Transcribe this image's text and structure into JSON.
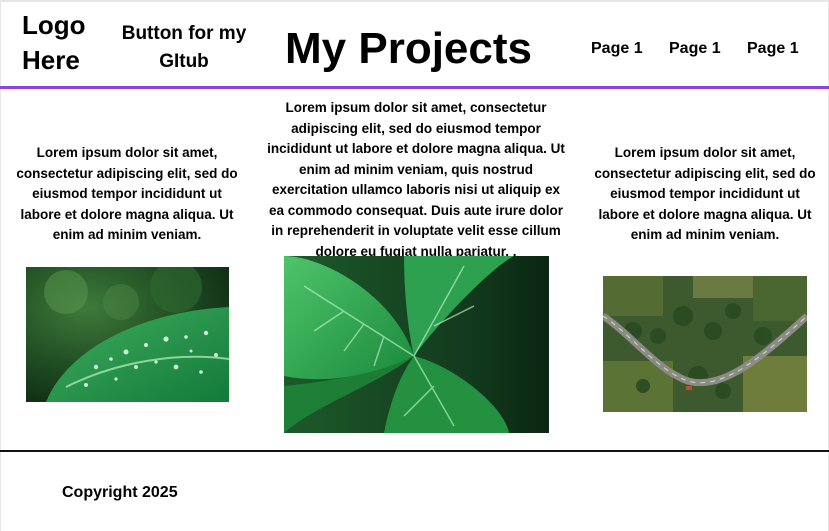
{
  "header": {
    "logo_line1": "Logo",
    "logo_line2": "Here",
    "github_button_line1": "Button for my",
    "github_button_line2": "GItub",
    "title": "My Projects",
    "nav": [
      "Page 1",
      "Page 1",
      "Page 1"
    ],
    "accent_color": "#8b43e0"
  },
  "columns": [
    {
      "text": "Lorem ipsum dolor sit amet, consectetur adipiscing elit, sed do eiusmod tempor incididunt ut labore et dolore magna aliqua. Ut enim ad minim veniam.",
      "image": "leaf-with-water-droplets"
    },
    {
      "text": "Lorem ipsum dolor sit amet, consectetur adipiscing elit, sed do eiusmod tempor incididunt ut labore et dolore magna aliqua. Ut enim ad minim veniam, quis nostrud exercitation ullamco laboris nisi ut aliquip ex ea commodo consequat. Duis aute irure dolor in reprehenderit in voluptate velit esse cillum dolore eu fugiat nulla pariatur. .",
      "image": "green-leaves-closeup"
    },
    {
      "text": "Lorem ipsum dolor sit amet, consectetur adipiscing elit, sed do eiusmod tempor incididunt ut labore et dolore magna aliqua. Ut enim ad minim veniam.",
      "image": "aerial-road-through-forest"
    }
  ],
  "footer": {
    "copyright": "Copyright 2025"
  }
}
